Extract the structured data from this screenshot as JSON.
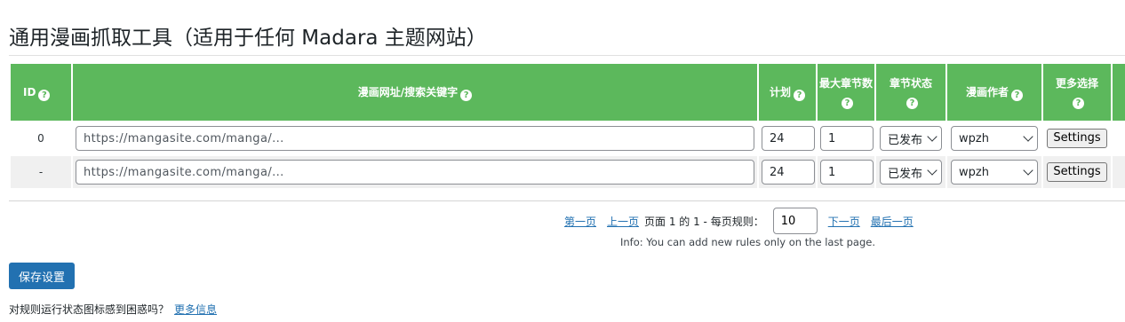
{
  "page": {
    "title": "通用漫画抓取工具（适用于任何 Madara 主题网站）"
  },
  "table": {
    "headers": {
      "id": "ID",
      "url": "漫画网址/搜索关键字",
      "plan": "计划",
      "max_chapters": "最大章节数",
      "chapter_status": "章节状态",
      "author": "漫画作者",
      "more": "更多选择"
    },
    "help_icon_glyph": "?",
    "rows": [
      {
        "id": "0",
        "url": "https://mangasite.com/manga/...",
        "plan": "24",
        "max_chapters": "1",
        "chapter_status": "已发布",
        "author": "wpzh",
        "settings_label": "Settings"
      },
      {
        "id": "-",
        "url": "https://mangasite.com/manga/...",
        "plan": "24",
        "max_chapters": "1",
        "chapter_status": "已发布",
        "author": "wpzh",
        "settings_label": "Settings"
      }
    ]
  },
  "pagination": {
    "first": "第一页",
    "prev": "上一页",
    "page_text": "页面 1 的 1 - 每页规则：",
    "per_page": "10",
    "next": "下一页",
    "last": "最后一页",
    "info": "Info: You can add new rules only on the last page."
  },
  "actions": {
    "save_label": "保存设置"
  },
  "footer": {
    "question": "对规则运行状态图标感到困惑吗？",
    "more_info": "更多信息"
  },
  "colors": {
    "header_green": "#5cb85c",
    "link_blue": "#2271b1",
    "button_blue": "#2271b1",
    "row_alt": "#f0f0f0"
  },
  "icons": {
    "help": "help-circle-icon",
    "dropdown": "chevron-down-icon"
  }
}
